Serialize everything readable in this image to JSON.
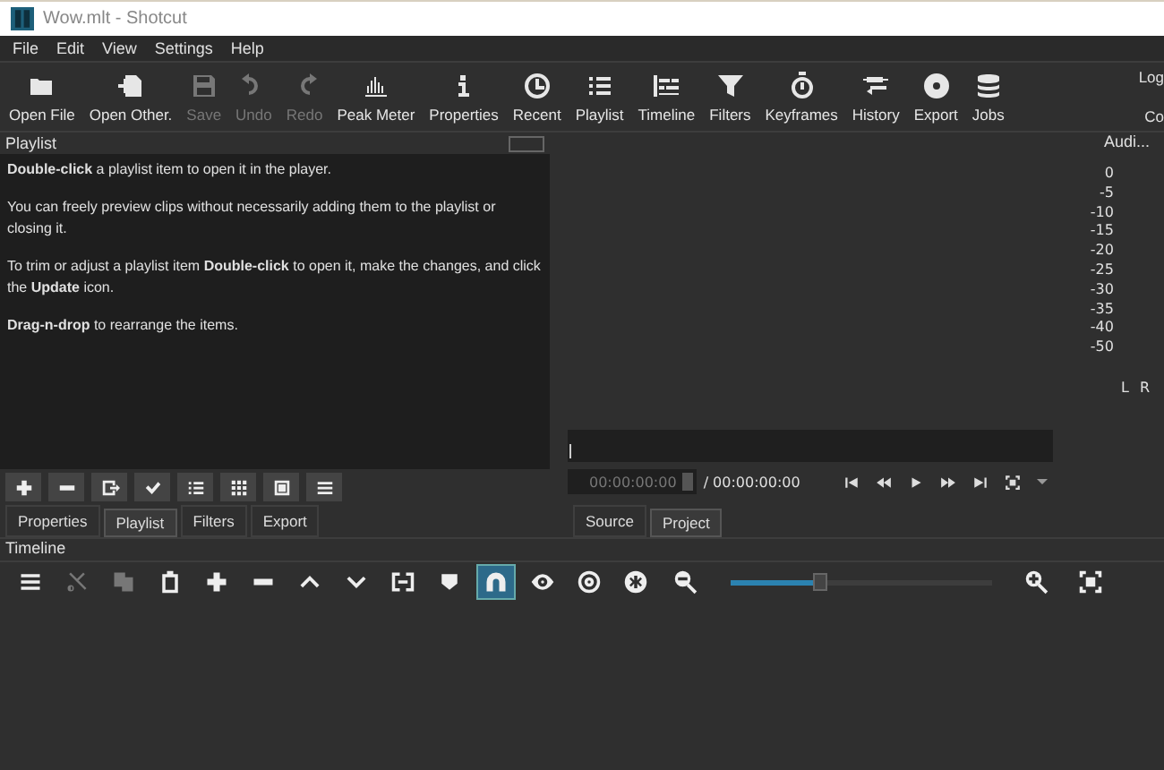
{
  "window": {
    "title": "Wow.mlt - Shotcut"
  },
  "menu": [
    "File",
    "Edit",
    "View",
    "Settings",
    "Help"
  ],
  "toolbar": [
    {
      "label": "Open File",
      "disabled": false
    },
    {
      "label": "Open Other.",
      "disabled": false
    },
    {
      "label": "Save",
      "disabled": true
    },
    {
      "label": "Undo",
      "disabled": true
    },
    {
      "label": "Redo",
      "disabled": true
    },
    {
      "label": "Peak Meter",
      "disabled": false
    },
    {
      "label": "Properties",
      "disabled": false
    },
    {
      "label": "Recent",
      "disabled": false
    },
    {
      "label": "Playlist",
      "disabled": false
    },
    {
      "label": "Timeline",
      "disabled": false
    },
    {
      "label": "Filters",
      "disabled": false
    },
    {
      "label": "Keyframes",
      "disabled": false
    },
    {
      "label": "History",
      "disabled": false
    },
    {
      "label": "Export",
      "disabled": false
    },
    {
      "label": "Jobs",
      "disabled": false
    }
  ],
  "toolbar_right": [
    "Log",
    "Co"
  ],
  "playlist": {
    "title": "Playlist",
    "paragraphs": [
      "**Double-click** a playlist item to open it in the player.",
      "You can freely preview clips without necessarily adding them to the playlist or closing it.",
      "To trim or adjust a playlist item **Double-click** to open it, make the changes, and click the **Update** icon.",
      "**Drag-n-drop** to rearrange the items."
    ],
    "tabs": [
      {
        "label": "Properties",
        "selected": false
      },
      {
        "label": "Playlist",
        "selected": true
      },
      {
        "label": "Filters",
        "selected": false
      },
      {
        "label": "Export",
        "selected": false
      }
    ]
  },
  "player": {
    "timecode": "00:00:00:00",
    "duration": "/ 00:00:00:00",
    "tabs": [
      {
        "label": "Source",
        "selected": false
      },
      {
        "label": "Project",
        "selected": true
      }
    ]
  },
  "audio_meter": {
    "title": "Audi...",
    "scale": [
      "0",
      "-5",
      "-10",
      "-15",
      "-20",
      "-25",
      "-30",
      "-35",
      "-40",
      "-50"
    ],
    "channels": [
      "L",
      "R"
    ]
  },
  "timeline": {
    "title": "Timeline",
    "tools": [
      {
        "disabled": false,
        "on": false
      },
      {
        "disabled": true,
        "on": false
      },
      {
        "disabled": true,
        "on": false
      },
      {
        "disabled": false,
        "on": false
      },
      {
        "disabled": false,
        "on": false
      },
      {
        "disabled": false,
        "on": false
      },
      {
        "disabled": false,
        "on": false
      },
      {
        "disabled": false,
        "on": false
      },
      {
        "disabled": false,
        "on": false
      },
      {
        "disabled": false,
        "on": false
      },
      {
        "disabled": false,
        "on": true
      },
      {
        "disabled": false,
        "on": false
      },
      {
        "disabled": false,
        "on": false
      },
      {
        "disabled": false,
        "on": false
      }
    ],
    "zoom": {
      "level": 0.34
    }
  }
}
